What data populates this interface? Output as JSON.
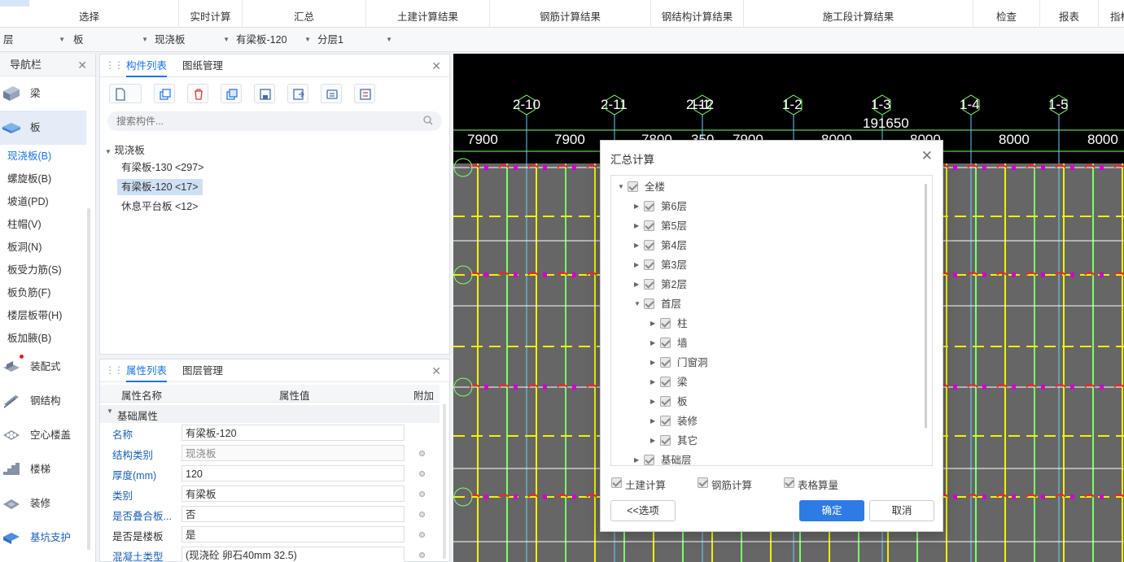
{
  "ribbon": {
    "groups": [
      "选择",
      "实时计算",
      "汇总",
      "土建计算结果",
      "钢筋计算结果",
      "钢结构计算结果",
      "施工段计算结果",
      "检查",
      "报表",
      "指标"
    ]
  },
  "selectors": {
    "floor": "层",
    "type": "板",
    "subtype": "现浇板",
    "component": "有梁板-120",
    "layer": "分层1"
  },
  "nav": {
    "title": "导航栏",
    "categories": [
      {
        "label": "梁",
        "icon": "beam-icon"
      },
      {
        "label": "板",
        "icon": "slab-icon"
      }
    ],
    "sub_items": [
      "现浇板(B)",
      "螺旋板(B)",
      "坡道(PD)",
      "柱帽(V)",
      "板洞(N)",
      "板受力筋(S)",
      "板负筋(F)",
      "楼层板带(H)",
      "板加腋(B)"
    ],
    "more_categories": [
      "装配式",
      "钢结构",
      "空心楼盖",
      "楼梯",
      "装修",
      "基坑支护"
    ]
  },
  "component_panel": {
    "tabs": [
      "构件列表",
      "图纸管理"
    ],
    "search_placeholder": "搜索构件...",
    "tree_root": "现浇板",
    "tree_items": [
      "有梁板-130 <297>",
      "有梁板-120 <17>",
      "休息平台板 <12>"
    ]
  },
  "property_panel": {
    "tabs": [
      "属性列表",
      "图层管理"
    ],
    "columns": [
      "属性名称",
      "属性值",
      "附加"
    ],
    "group_label": "基础属性",
    "rows": [
      {
        "name": "名称",
        "value": "有梁板-120"
      },
      {
        "name": "结构类别",
        "value": "现浇板"
      },
      {
        "name": "厚度(mm)",
        "value": "120"
      },
      {
        "name": "类别",
        "value": "有梁板"
      },
      {
        "name": "是否叠合板...",
        "value": "否"
      },
      {
        "name": "是否是楼板",
        "value": "是"
      },
      {
        "name": "混凝土类型",
        "value": "(现浇砼 卵石40mm 32.5)"
      }
    ]
  },
  "canvas": {
    "axis_labels": [
      "2-10",
      "2-11",
      "2-12",
      "1-1",
      "1-2",
      "1-3",
      "1-4",
      "1-5"
    ],
    "total_dimension": "191650",
    "dimensions": [
      "7900",
      "7900",
      "7800",
      "350",
      "7900",
      "8000",
      "8000",
      "8000",
      "8000"
    ],
    "colors": {
      "background": "#000000",
      "slab": "#666666",
      "rebar_green": "#7dff6a",
      "rebar_yellow": "#f2f200",
      "marker_red": "#ff2020",
      "grid_cyan": "#6ad2ff"
    }
  },
  "dialog": {
    "title": "汇总计算",
    "tree": {
      "root": "全楼",
      "floors": [
        "第6层",
        "第5层",
        "第4层",
        "第3层",
        "第2层",
        "首层"
      ],
      "first_floor_children": [
        "柱",
        "墙",
        "门窗洞",
        "梁",
        "板",
        "装修",
        "其它"
      ],
      "last": "基础层"
    },
    "options": [
      "土建计算",
      "钢筋计算",
      "表格算量"
    ],
    "buttons": {
      "options": "<<选项",
      "ok": "确定",
      "cancel": "取消"
    }
  }
}
